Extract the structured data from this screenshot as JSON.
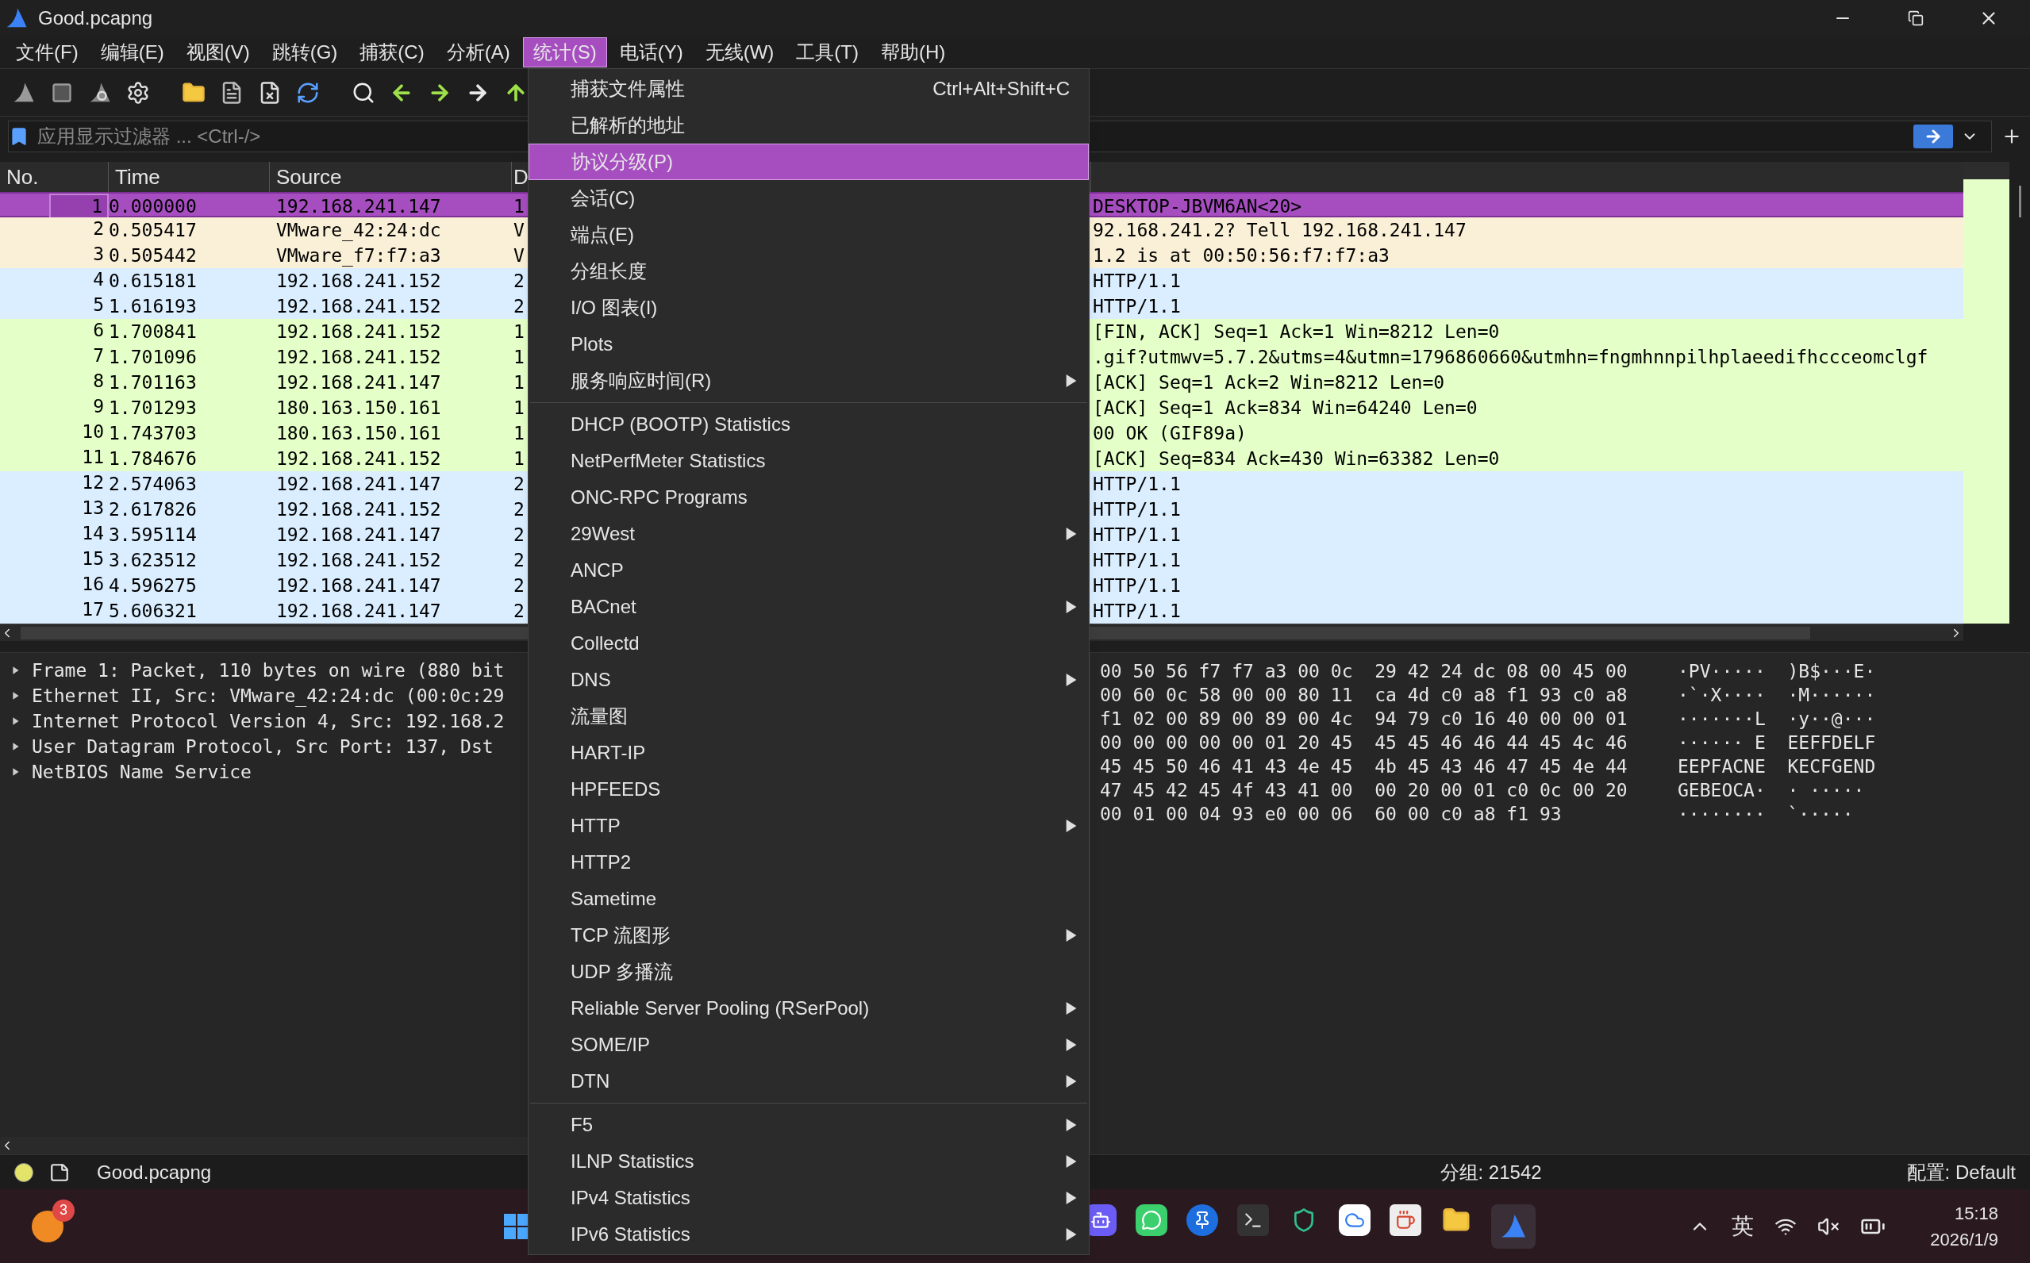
{
  "window": {
    "title": "Good.pcapng"
  },
  "menubar": [
    {
      "label": "文件(F)",
      "selected": false
    },
    {
      "label": "编辑(E)",
      "selected": false
    },
    {
      "label": "视图(V)",
      "selected": false
    },
    {
      "label": "跳转(G)",
      "selected": false
    },
    {
      "label": "捕获(C)",
      "selected": false
    },
    {
      "label": "分析(A)",
      "selected": false
    },
    {
      "label": "统计(S)",
      "selected": true
    },
    {
      "label": "电话(Y)",
      "selected": false
    },
    {
      "label": "无线(W)",
      "selected": false
    },
    {
      "label": "工具(T)",
      "selected": false
    },
    {
      "label": "帮助(H)",
      "selected": false
    }
  ],
  "filter": {
    "placeholder": "应用显示过滤器 ... <Ctrl-/>"
  },
  "packet_list": {
    "columns": [
      "No.",
      "Time",
      "Source",
      "D"
    ],
    "rows": [
      {
        "no": "1",
        "time": "0.000000",
        "source": "192.168.241.147",
        "column_4": "1",
        "info": "DESKTOP-JBVM6AN<20>",
        "color": "#a64dc0",
        "selected": true
      },
      {
        "no": "2",
        "time": "0.505417",
        "source": "VMware_42:24:dc",
        "column_4": "V",
        "info": "92.168.241.2? Tell 192.168.241.147",
        "color": "#faf0d7",
        "selected": false
      },
      {
        "no": "3",
        "time": "0.505442",
        "source": "VMware_f7:f7:a3",
        "column_4": "V",
        "info": "1.2 is at 00:50:56:f7:f7:a3",
        "color": "#faf0d7",
        "selected": false
      },
      {
        "no": "4",
        "time": "0.615181",
        "source": "192.168.241.152",
        "column_4": "2",
        "info": "HTTP/1.1",
        "color": "#daeeff",
        "selected": false
      },
      {
        "no": "5",
        "time": "1.616193",
        "source": "192.168.241.152",
        "column_4": "2",
        "info": "HTTP/1.1",
        "color": "#daeeff",
        "selected": false
      },
      {
        "no": "6",
        "time": "1.700841",
        "source": "192.168.241.152",
        "column_4": "1",
        "info": "[FIN, ACK] Seq=1 Ack=1 Win=8212 Len=0",
        "color": "#e4ffc7",
        "selected": false
      },
      {
        "no": "7",
        "time": "1.701096",
        "source": "192.168.241.152",
        "column_4": "1",
        "info": ".gif?utmwv=5.7.2&utms=4&utmn=1796860660&utmhn=fngmhnnpilhplaeedifhccceomclgf",
        "color": "#e4ffc7",
        "selected": false
      },
      {
        "no": "8",
        "time": "1.701163",
        "source": "192.168.241.147",
        "column_4": "1",
        "info": "[ACK] Seq=1 Ack=2 Win=8212 Len=0",
        "color": "#e4ffc7",
        "selected": false
      },
      {
        "no": "9",
        "time": "1.701293",
        "source": "180.163.150.161",
        "column_4": "1",
        "info": "[ACK] Seq=1 Ack=834 Win=64240 Len=0",
        "color": "#e4ffc7",
        "selected": false
      },
      {
        "no": "10",
        "time": "1.743703",
        "source": "180.163.150.161",
        "column_4": "1",
        "info": "00 OK  (GIF89a)",
        "color": "#e4ffc7",
        "selected": false
      },
      {
        "no": "11",
        "time": "1.784676",
        "source": "192.168.241.152",
        "column_4": "1",
        "info": "[ACK] Seq=834 Ack=430 Win=63382 Len=0",
        "color": "#e4ffc7",
        "selected": false
      },
      {
        "no": "12",
        "time": "2.574063",
        "source": "192.168.241.147",
        "column_4": "2",
        "info": "HTTP/1.1",
        "color": "#daeeff",
        "selected": false
      },
      {
        "no": "13",
        "time": "2.617826",
        "source": "192.168.241.152",
        "column_4": "2",
        "info": "HTTP/1.1",
        "color": "#daeeff",
        "selected": false
      },
      {
        "no": "14",
        "time": "3.595114",
        "source": "192.168.241.147",
        "column_4": "2",
        "info": "HTTP/1.1",
        "color": "#daeeff",
        "selected": false
      },
      {
        "no": "15",
        "time": "3.623512",
        "source": "192.168.241.152",
        "column_4": "2",
        "info": "HTTP/1.1",
        "color": "#daeeff",
        "selected": false
      },
      {
        "no": "16",
        "time": "4.596275",
        "source": "192.168.241.147",
        "column_4": "2",
        "info": "HTTP/1.1",
        "color": "#daeeff",
        "selected": false
      },
      {
        "no": "17",
        "time": "5.606321",
        "source": "192.168.241.147",
        "column_4": "2",
        "info": "HTTP/1.1",
        "color": "#daeeff",
        "selected": false
      }
    ]
  },
  "details": [
    {
      "text": "Frame 1: Packet, 110 bytes on wire (880 bit",
      "expanded": false
    },
    {
      "text": "Ethernet II, Src: VMware_42:24:dc (00:0c:29",
      "expanded": false
    },
    {
      "text": "Internet Protocol Version 4, Src: 192.168.2",
      "expanded": false
    },
    {
      "text": "User Datagram Protocol, Src Port: 137, Dst",
      "expanded": false
    },
    {
      "text": "NetBIOS Name Service",
      "expanded": false
    }
  ],
  "bytes": [
    {
      "hex": "00 50 56 f7 f7 a3 00 0c  29 42 24 dc 08 00 45 00",
      "ascii": "·PV·····  )B$···E·"
    },
    {
      "hex": "00 60 0c 58 00 00 80 11  ca 4d c0 a8 f1 93 c0 a8",
      "ascii": "·`·X····  ·M······"
    },
    {
      "hex": "f1 02 00 89 00 89 00 4c  94 79 c0 16 40 00 00 01",
      "ascii": "·······L  ·y··@···"
    },
    {
      "hex": "00 00 00 00 00 01 20 45  45 45 46 46 44 45 4c 46",
      "ascii": "······ E  EEFFDELF"
    },
    {
      "hex": "45 45 50 46 41 43 4e 45  4b 45 43 46 47 45 4e 44",
      "ascii": "EEPFACNE  KECFGEND"
    },
    {
      "hex": "47 45 42 45 4f 43 41 00  00 20 00 01 c0 0c 00 20",
      "ascii": "GEBEOCA·  · ····· "
    },
    {
      "hex": "00 01 00 04 93 e0 00 06  60 00 c0 a8 f1 93",
      "ascii": "········  `·····"
    }
  ],
  "stats_menu": {
    "items": [
      {
        "kind": "item",
        "label": "捕获文件属性",
        "shortcut": "Ctrl+Alt+Shift+C",
        "submenu": false,
        "selected": false
      },
      {
        "kind": "item",
        "label": "已解析的地址",
        "submenu": false,
        "selected": false
      },
      {
        "kind": "item",
        "label": "协议分级(P)",
        "submenu": false,
        "selected": true
      },
      {
        "kind": "item",
        "label": "会话(C)",
        "submenu": false,
        "selected": false
      },
      {
        "kind": "item",
        "label": "端点(E)",
        "submenu": false,
        "selected": false
      },
      {
        "kind": "item",
        "label": "分组长度",
        "submenu": false,
        "selected": false
      },
      {
        "kind": "item",
        "label": "I/O 图表(I)",
        "submenu": false,
        "selected": false
      },
      {
        "kind": "item",
        "label": "Plots",
        "submenu": false,
        "selected": false
      },
      {
        "kind": "item",
        "label": "服务响应时间(R)",
        "submenu": true,
        "selected": false
      },
      {
        "kind": "separator"
      },
      {
        "kind": "item",
        "label": "DHCP (BOOTP) Statistics",
        "submenu": false,
        "selected": false
      },
      {
        "kind": "item",
        "label": "NetPerfMeter Statistics",
        "submenu": false,
        "selected": false
      },
      {
        "kind": "item",
        "label": "ONC-RPC Programs",
        "submenu": false,
        "selected": false
      },
      {
        "kind": "item",
        "label": "29West",
        "submenu": true,
        "selected": false
      },
      {
        "kind": "item",
        "label": "ANCP",
        "submenu": false,
        "selected": false
      },
      {
        "kind": "item",
        "label": "BACnet",
        "submenu": true,
        "selected": false
      },
      {
        "kind": "item",
        "label": "Collectd",
        "submenu": false,
        "selected": false
      },
      {
        "kind": "item",
        "label": "DNS",
        "submenu": true,
        "selected": false
      },
      {
        "kind": "item",
        "label": "流量图",
        "submenu": false,
        "selected": false
      },
      {
        "kind": "item",
        "label": "HART-IP",
        "submenu": false,
        "selected": false
      },
      {
        "kind": "item",
        "label": "HPFEEDS",
        "submenu": false,
        "selected": false
      },
      {
        "kind": "item",
        "label": "HTTP",
        "submenu": true,
        "selected": false
      },
      {
        "kind": "item",
        "label": "HTTP2",
        "submenu": false,
        "selected": false
      },
      {
        "kind": "item",
        "label": "Sametime",
        "submenu": false,
        "selected": false
      },
      {
        "kind": "item",
        "label": "TCP 流图形",
        "submenu": true,
        "selected": false
      },
      {
        "kind": "item",
        "label": "UDP 多播流",
        "submenu": false,
        "selected": false
      },
      {
        "kind": "item",
        "label": "Reliable Server Pooling (RSerPool)",
        "submenu": true,
        "selected": false
      },
      {
        "kind": "item",
        "label": "SOME/IP",
        "submenu": true,
        "selected": false
      },
      {
        "kind": "item",
        "label": "DTN",
        "submenu": true,
        "selected": false
      },
      {
        "kind": "separator"
      },
      {
        "kind": "item",
        "label": "F5",
        "submenu": true,
        "selected": false
      },
      {
        "kind": "item",
        "label": "ILNP Statistics",
        "submenu": true,
        "selected": false
      },
      {
        "kind": "item",
        "label": "IPv4 Statistics",
        "submenu": true,
        "selected": false
      },
      {
        "kind": "item",
        "label": "IPv6 Statistics",
        "submenu": true,
        "selected": false
      }
    ]
  },
  "status_bar": {
    "file": "Good.pcapng",
    "packets": "分组: 21542",
    "profile": "配置: Default"
  },
  "taskbar": {
    "badge": "3",
    "ime": "英",
    "time": "15:18",
    "date": "2026/1/9"
  }
}
